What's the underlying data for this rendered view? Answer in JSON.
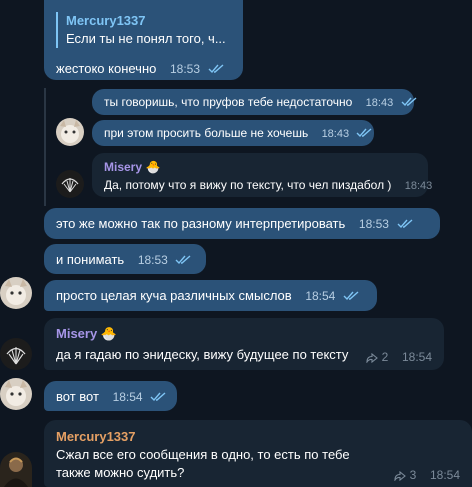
{
  "reply_bubble": {
    "reply_author": "Mercury1337",
    "reply_text": "Если ты не понял того, ч...",
    "text": "жестоко конечно",
    "time": "18:53"
  },
  "nested": {
    "msg1": {
      "text": "ты говоришь, что пруфов тебе недостаточно",
      "time": "18:43"
    },
    "msg2": {
      "text": "при этом просить больше не хочешь",
      "time": "18:43"
    },
    "msg3": {
      "sender": "Misery",
      "text": "Да, потому что я вижу по тексту, что чел пиздабол )",
      "time": "18:43"
    }
  },
  "messages": [
    {
      "text": "это же можно так по разному интерпретировать",
      "time": "18:53"
    },
    {
      "text": "и понимать",
      "time": "18:53"
    },
    {
      "text": "просто целая куча различных смыслов",
      "time": "18:54"
    }
  ],
  "misery_msg": {
    "sender": "Misery",
    "text": "да я гадаю по энидеску, вижу будущее по тексту",
    "forwards": "2",
    "time": "18:54"
  },
  "vot_msg": {
    "text": "вот вот",
    "time": "18:54"
  },
  "mercury_msg": {
    "sender": "Mercury1337",
    "text": "Сжал все его сообщения в одно, то есть по тебе также можно судить?",
    "forwards": "3",
    "time": "18:54"
  },
  "colors": {
    "background": "#0e1621",
    "outgoing": "#2b5278",
    "incoming": "#182533",
    "misery_name": "#a695e7",
    "mercury_name": "#e5a064",
    "reply_name": "#7fc5f5"
  }
}
